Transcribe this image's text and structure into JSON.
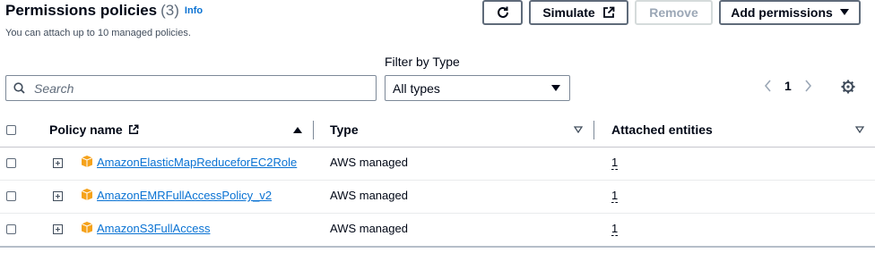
{
  "header": {
    "title": "Permissions policies",
    "count": "(3)",
    "info_link": "Info",
    "subtitle": "You can attach up to 10 managed policies."
  },
  "toolbar": {
    "refresh_icon": "refresh-icon",
    "simulate_label": "Simulate",
    "remove_label": "Remove",
    "add_permissions_label": "Add permissions"
  },
  "filters": {
    "search_placeholder": "Search",
    "filter_by_type_label": "Filter by Type",
    "type_selected": "All types"
  },
  "pagination": {
    "current_page": "1"
  },
  "table": {
    "columns": [
      "Policy name",
      "Type",
      "Attached entities"
    ],
    "rows": [
      {
        "policy_name": "AmazonElasticMapReduceforEC2Role",
        "type": "AWS managed",
        "attached_entities": "1"
      },
      {
        "policy_name": "AmazonEMRFullAccessPolicy_v2",
        "type": "AWS managed",
        "attached_entities": "1"
      },
      {
        "policy_name": "AmazonS3FullAccess",
        "type": "AWS managed",
        "attached_entities": "1"
      }
    ]
  },
  "colors": {
    "link": "#0972d3",
    "policy_icon": "#f5a21b",
    "border": "#5f6b7a"
  }
}
